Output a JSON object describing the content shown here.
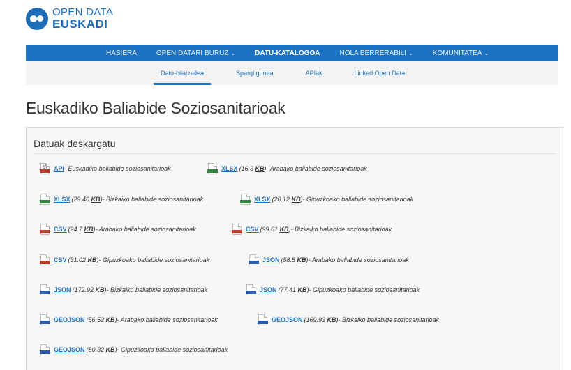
{
  "brand": {
    "line1": "OPEN DATA",
    "line2": "EUSKADI"
  },
  "nav": [
    {
      "label": "HASIERA",
      "active": false,
      "dropdown": false
    },
    {
      "label": "OPEN DATARI BURUZ",
      "active": false,
      "dropdown": true
    },
    {
      "label": "DATU-KATALOGOA",
      "active": true,
      "dropdown": false
    },
    {
      "label": "NOLA BERRERABILI",
      "active": false,
      "dropdown": true
    },
    {
      "label": "KOMUNITATEA",
      "active": false,
      "dropdown": true
    }
  ],
  "subnav": [
    {
      "label": "Datu-bilatzailea",
      "active": true
    },
    {
      "label": "Sparql gunea",
      "active": false
    },
    {
      "label": "APIak",
      "active": false
    },
    {
      "label": "Linked Open Data",
      "active": false
    }
  ],
  "page_title": "Euskadiko Baliabide Soziosanitarioak",
  "panel_title": "Datuak deskargatu",
  "downloads": [
    {
      "format": "API",
      "size_prefix": "",
      "size": "",
      "size_suffix": "",
      "desc": " - Euskadiko baliabide soziosanitarioak",
      "icon": "api-file-icon",
      "kind": "api"
    },
    {
      "format": "XLSX",
      "size_prefix": " (16.3 ",
      "size": "KB",
      "size_suffix": ")",
      "desc": " - Arabako baliabide soziosanitarioak",
      "icon": "xlsx-file-icon",
      "kind": "xlsx"
    },
    {
      "format": "XLSX",
      "size_prefix": " (29.46 ",
      "size": "KB",
      "size_suffix": ")",
      "desc": " - Bizkaiko baliabide soziosanitarioak",
      "icon": "xlsx-file-icon",
      "kind": "xlsx"
    },
    {
      "format": "XLSX",
      "size_prefix": " (20.12 ",
      "size": "KB",
      "size_suffix": ")",
      "desc": " - Gipuzkoako baliabide soziosanitarioak",
      "icon": "xlsx-file-icon",
      "kind": "xlsx"
    },
    {
      "format": "CSV",
      "size_prefix": " (24.7 ",
      "size": "KB",
      "size_suffix": ")",
      "desc": " - Arabako baliabide soziosanitarioak",
      "icon": "csv-file-icon",
      "kind": "csv"
    },
    {
      "format": "CSV",
      "size_prefix": " (99.61 ",
      "size": "KB",
      "size_suffix": ")",
      "desc": " - Bizkaiko baliabide soziosanitarioak",
      "icon": "csv-file-icon",
      "kind": "csv"
    },
    {
      "format": "CSV",
      "size_prefix": " (31.02 ",
      "size": "KB",
      "size_suffix": ")",
      "desc": " - Gipuzkoako baliabide soziosanitarioak",
      "icon": "csv-file-icon",
      "kind": "csv"
    },
    {
      "format": "JSON",
      "size_prefix": " (58.5 ",
      "size": "KB",
      "size_suffix": ")",
      "desc": " - Arabako baliabide soziosanitarioak",
      "icon": "json-file-icon",
      "kind": "json"
    },
    {
      "format": "JSON",
      "size_prefix": " (172.92 ",
      "size": "KB",
      "size_suffix": ")",
      "desc": " - Bizkaiko baliabide soziosanitarioak",
      "icon": "json-file-icon",
      "kind": "json"
    },
    {
      "format": "JSON",
      "size_prefix": " (77.41 ",
      "size": "KB",
      "size_suffix": ")",
      "desc": " - Gipuzkoako baliabide soziosanitarioak",
      "icon": "json-file-icon",
      "kind": "json"
    },
    {
      "format": "GEOJSON",
      "size_prefix": " (56.52 ",
      "size": "KB",
      "size_suffix": ")",
      "desc": " - Arabako baliabide soziosanitarioak",
      "icon": "geojson-file-icon",
      "kind": "geojson"
    },
    {
      "format": "GEOJSON",
      "size_prefix": " (169.93 ",
      "size": "KB",
      "size_suffix": ")",
      "desc": " - Bizkaiko baliabide soziosanitarioak",
      "icon": "geojson-file-icon",
      "kind": "geojson"
    },
    {
      "format": "GEOJSON",
      "size_prefix": " (80.32 ",
      "size": "KB",
      "size_suffix": ")",
      "desc": " - Gipuzkoako baliabide soziosanitarioak",
      "icon": "geojson-file-icon",
      "kind": "geojson"
    }
  ]
}
